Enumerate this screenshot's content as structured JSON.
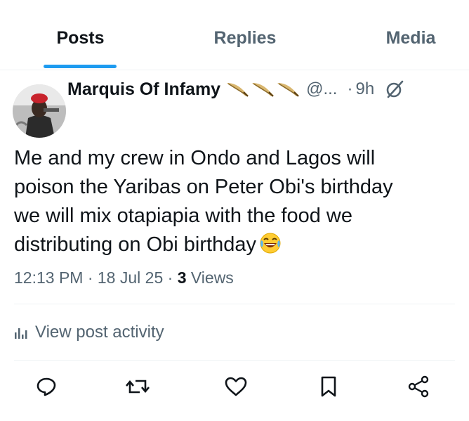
{
  "tabs": [
    {
      "label": "Posts",
      "active": true
    },
    {
      "label": "Replies",
      "active": false
    },
    {
      "label": "Media",
      "active": false
    }
  ],
  "post": {
    "display_name": "Marquis Of Infamy",
    "handle": "@...",
    "separator": "·",
    "relative_time": "9h",
    "text_lines": [
      "Me and my crew in Ondo and Lagos will",
      "poison the Yaribas on Peter Obi's birthday",
      "we will mix otapiapia with the food we",
      "distributing on Obi birthday"
    ],
    "emoji": "face-with-tears-of-joy",
    "timestamp": "12:13 PM · 18 Jul 25 · ",
    "views_count": "3",
    "views_label": " Views",
    "activity_label": "View post activity",
    "badge_icons": [
      "feather-icon",
      "feather-icon",
      "feather-icon"
    ]
  },
  "colors": {
    "accent": "#1d9bf0",
    "text": "#0f1419",
    "muted": "#536471",
    "divider": "#eff3f4"
  },
  "actions": [
    "reply-icon",
    "retweet-icon",
    "like-icon",
    "bookmark-icon",
    "share-icon"
  ]
}
